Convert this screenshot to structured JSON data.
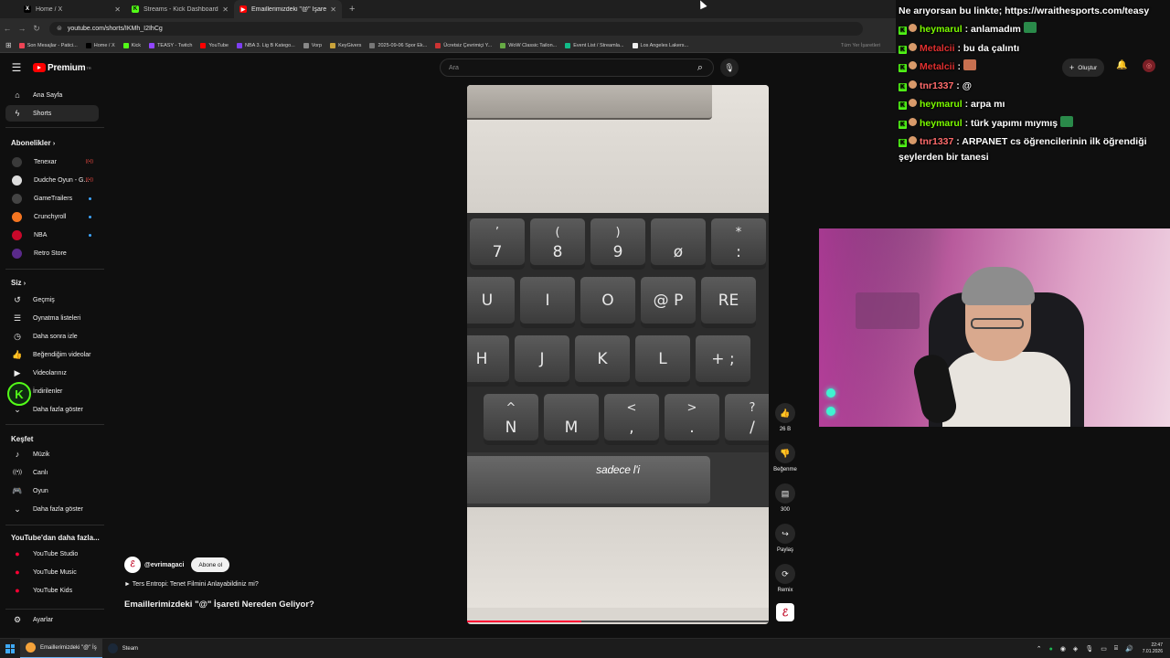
{
  "browser": {
    "tabs": [
      {
        "label": "Home / X",
        "fav": "X",
        "favColor": "#000000"
      },
      {
        "label": "Streams - Kick Dashboard",
        "fav": "K",
        "favColor": "#53fc18"
      },
      {
        "label": "Emaillerimizdeki \"@\" İşareti",
        "fav": "▶",
        "favColor": "#ff0000"
      }
    ],
    "url": "youtube.com/shorts/IKMh_I2IhCg",
    "bookmarks": [
      "Son Mesajlar - Patici...",
      "Home / X",
      "Kick",
      "TEASY - Twitch",
      "YouTube",
      "NBA 3. Lig B Katego...",
      "Vorp",
      "KeyGivers",
      "2025-09-06 Spor Ek...",
      "Ücretsiz Çevrimiçi Y...",
      "WoW Classic Tailon...",
      "Event List / Streamla...",
      "Los Angeles Lakers..."
    ],
    "bookmarks_right": "Tüm Yer İşaretleri"
  },
  "masthead": {
    "logo": "Premium",
    "logo_sup": "TR",
    "search_placeholder": "Ara",
    "create_label": "Oluştur"
  },
  "sidebar": {
    "home": "Ana Sayfa",
    "shorts": "Shorts",
    "subs_heading": "Abonelikler",
    "subs": [
      {
        "label": "Tenexar",
        "color": "#3a3a3a",
        "indicator": "live"
      },
      {
        "label": "Dudche Oyun - G...",
        "color": "#ddd",
        "indicator": "live"
      },
      {
        "label": "GameTrailers",
        "color": "#444",
        "indicator": "dot"
      },
      {
        "label": "Crunchyroll",
        "color": "#f47521",
        "indicator": "dot"
      },
      {
        "label": "NBA",
        "color": "#c9082a",
        "indicator": "dot"
      },
      {
        "label": "Retro Store",
        "color": "#5a2a8a",
        "indicator": ""
      }
    ],
    "you_heading": "Siz",
    "you_items": [
      "Geçmiş",
      "Oynatma listeleri",
      "Daha sonra izle",
      "Beğendiğim videolar",
      "Videolarınız",
      "İndirilenler",
      "Daha fazla göster"
    ],
    "explore_heading": "Keşfet",
    "explore_items": [
      "Müzik",
      "Canlı",
      "Oyun",
      "Daha fazla göster"
    ],
    "more_heading": "YouTube'dan daha fazla...",
    "more_items": [
      "YouTube Studio",
      "YouTube Music",
      "YouTube Kids"
    ],
    "settings": "Ayarlar"
  },
  "video": {
    "keys_row1": [
      {
        "top": "’",
        "bot": "7"
      },
      {
        "top": "(",
        "bot": "8"
      },
      {
        "top": ")",
        "bot": "9"
      },
      {
        "top": "",
        "bot": "ø"
      },
      {
        "top": "*",
        "bot": ":"
      }
    ],
    "keys_row2": [
      "U",
      "I",
      "O",
      "@ P",
      "RE"
    ],
    "keys_row3": [
      "H",
      "J",
      "K",
      "L",
      "+ ;"
    ],
    "keys_row4": [
      {
        "top": "^",
        "bot": "N"
      },
      {
        "top": "",
        "bot": "M"
      },
      {
        "top": "<",
        "bot": ","
      },
      {
        "top": ">",
        "bot": "."
      },
      {
        "top": "?",
        "bot": "/"
      }
    ],
    "caption": "sadece l'i",
    "progress": 0.38
  },
  "actions": {
    "like_count": "26 B",
    "dislike_label": "Beğenme",
    "comments_count": "300",
    "share_label": "Paylaş",
    "remix_label": "Remix"
  },
  "meta": {
    "channel": "@evrimagaci",
    "subscribe": "Abone ol",
    "related": "► Ters Entropi: Tenet Filmini Anlayabildiniz mi?",
    "title": "Emaillerimizdeki \"@\" İşareti Nereden Geliyor?"
  },
  "chat": {
    "pinned": "Ne arıyorsan bu linkte; https://wraithesports.com/teasy",
    "messages": [
      {
        "user": "heymarul",
        "userColor": "#7cfc00",
        "text": ": anlamadım"
      },
      {
        "user": "Metalcii",
        "userColor": "#e03030",
        "text": ": bu da çalıntı"
      },
      {
        "user": "Metalcii",
        "userColor": "#e03030",
        "text": ":"
      },
      {
        "user": "tnr1337",
        "userColor": "#ff6b6b",
        "text": ": @"
      },
      {
        "user": "heymarul",
        "userColor": "#7cfc00",
        "text": ": arpa mı"
      },
      {
        "user": "heymarul",
        "userColor": "#7cfc00",
        "text": ": türk yapımı mıymış"
      }
    ],
    "last_user": "tnr1337",
    "last_text": ": ARPANET cs öğrencilerinin ilk öğrendiği şeylerden bir tanesi"
  },
  "taskbar": {
    "apps": [
      {
        "label": "Emaillerimizdeki \"@\" İş",
        "active": true,
        "color": "#f4a23a"
      },
      {
        "label": "Steam",
        "active": false,
        "color": "#1b2838"
      }
    ],
    "time": "22:47",
    "date": "7.01.2026"
  }
}
